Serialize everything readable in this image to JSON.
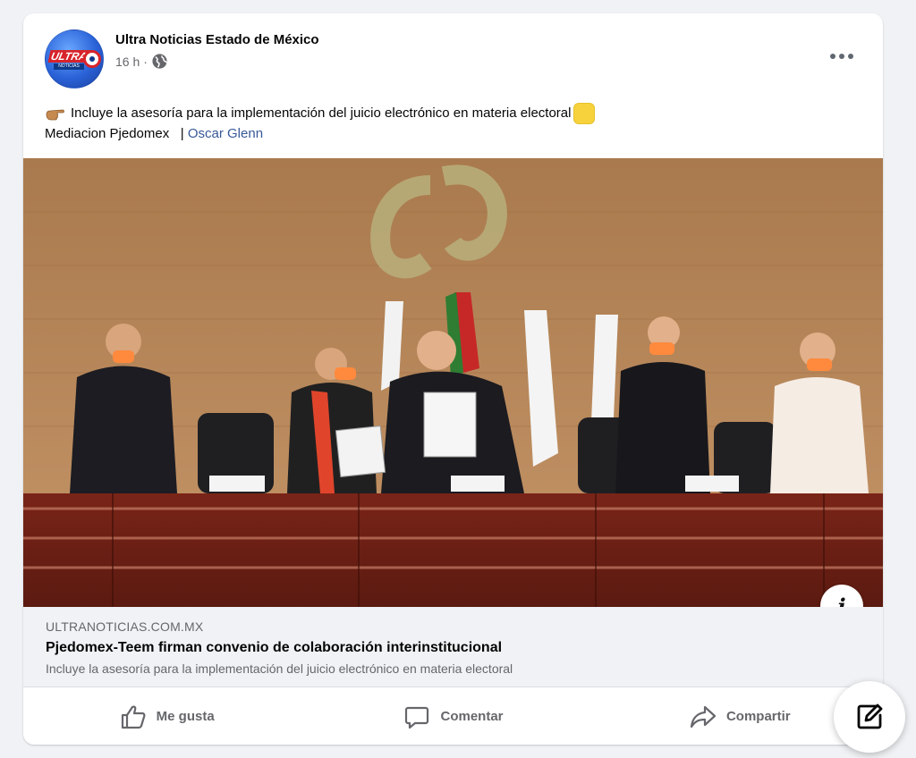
{
  "post": {
    "page_name": "Ultra Noticias Estado de México",
    "time": "16 h",
    "separator": "·",
    "audience_icon": "globe-icon",
    "more_icon": "more-dots-icon",
    "avatar": {
      "logo_text": "ULTRA",
      "logo_subtext": "NOTICIAS"
    },
    "text_line1": "Incluye la asesoría para la implementación del juicio electrónico en materia electoral",
    "text_line1_leading_icon": "pointing-hand-icon",
    "text_line1_trailing_icon": "yellow-square-emoji",
    "text_line2": "Mediacion Pjedomex",
    "text_line2_separator": "|",
    "mention": "Oscar Glenn"
  },
  "photo": {
    "alt": "",
    "info_icon": "info-icon",
    "info_glyph": "i"
  },
  "link_preview": {
    "domain": "ULTRANOTICIAS.COM.MX",
    "title": "Pjedomex-Teem firman convenio de colaboración interinstitucional",
    "description": "Incluye la asesoría para la implementación del juicio electrónico en materia electoral"
  },
  "actions": {
    "like_label": "Me gusta",
    "comment_label": "Comentar",
    "share_label": "Compartir"
  },
  "colors": {
    "mention": "#385898",
    "muted": "#65676b",
    "background": "#f0f2f5"
  }
}
